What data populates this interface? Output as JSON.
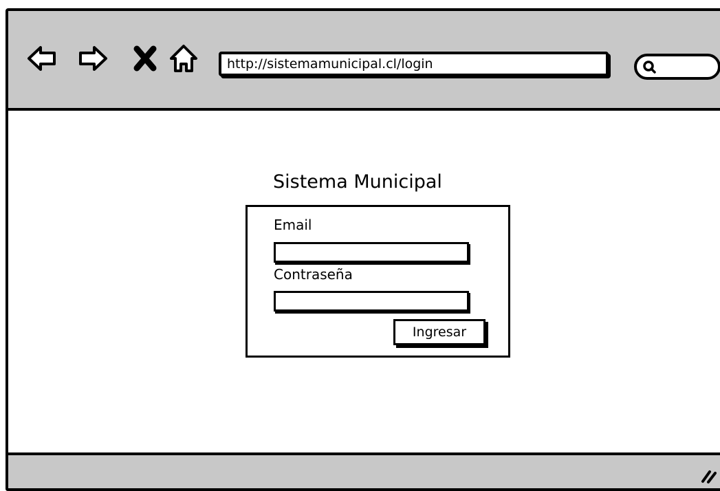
{
  "browser": {
    "url": "http://sistemamunicipal.cl/login",
    "nav": {
      "back": "back-arrow-icon",
      "forward": "forward-arrow-icon",
      "stop": "close-icon",
      "home": "home-icon"
    },
    "search_icon": "search-icon"
  },
  "login": {
    "title": "Sistema Municipal",
    "email_label": "Email",
    "email_value": "",
    "password_label": "Contraseña",
    "password_value": "",
    "submit_label": "Ingresar"
  },
  "colors": {
    "chrome": "#c8c8c8",
    "ink": "#000000",
    "paper": "#ffffff"
  }
}
